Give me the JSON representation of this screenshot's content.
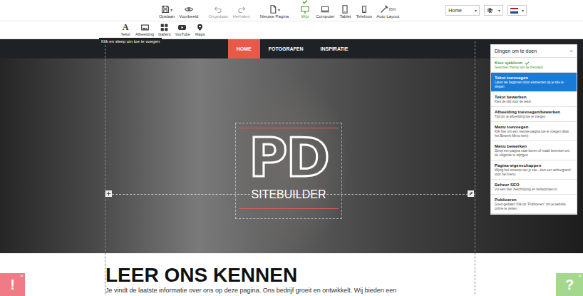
{
  "toolbar": {
    "caret": "▾",
    "items": [
      {
        "label": "Opslaan",
        "has_menu": true,
        "disabled": false,
        "selected": false
      },
      {
        "label": "Voorbeeld",
        "has_menu": false,
        "disabled": false,
        "selected": false
      },
      {
        "label": "Ongedaan",
        "has_menu": false,
        "disabled": true,
        "selected": false
      },
      {
        "label": "Herhalen",
        "has_menu": false,
        "disabled": true,
        "selected": false
      },
      {
        "label": "Nieuwe Pagina",
        "has_menu": true,
        "disabled": false,
        "selected": false
      },
      {
        "label": "Wijz",
        "has_menu": false,
        "disabled": false,
        "selected": true
      },
      {
        "label": "Computer",
        "has_menu": false,
        "disabled": false,
        "selected": false
      },
      {
        "label": "Tablet",
        "has_menu": false,
        "disabled": false,
        "selected": false
      },
      {
        "label": "Telefoon",
        "has_menu": false,
        "disabled": false,
        "selected": false
      },
      {
        "label": "Auto Layout",
        "has_menu": false,
        "disabled": false,
        "selected": false,
        "percent": "85%"
      }
    ],
    "page_select": {
      "value": "Home"
    }
  },
  "widgets": {
    "items": [
      {
        "label": "Tekst",
        "glyph": "A"
      },
      {
        "label": "Afbeelding"
      },
      {
        "label": "Gallerij"
      },
      {
        "label": "YouTube"
      },
      {
        "label": "Maps"
      }
    ],
    "tooltip": "Klik en sleep om toe te voegen"
  },
  "nav": {
    "items": [
      {
        "label": "HOME",
        "selected": true
      },
      {
        "label": "FOTOGRAFEN",
        "selected": false
      },
      {
        "label": "INSPIRATIE",
        "selected": false
      }
    ]
  },
  "hero": {
    "logo_mark": "PD",
    "logo_text": "SITEBUILDER"
  },
  "content": {
    "heading": "LEER ONS KENNEN",
    "paragraph": "Je vindt de laatste informatie over ons op deze pagina. Ons bedrijf groeit en ontwikkelt. Wij bieden een"
  },
  "todo_panel": {
    "title": "Dingen om te doen",
    "close": "×",
    "items": [
      {
        "title": "Kies sjabloon",
        "description": "Selecteer thema van de thema(s)",
        "done": true,
        "selected": false
      },
      {
        "title": "Tekst toevoegen",
        "description": "Laten we beginnen door elementen op je site te slepen",
        "done": false,
        "selected": true
      },
      {
        "title": "Tekst bewerken",
        "description": "Kies de stijl voor de tekst",
        "done": false,
        "selected": false
      },
      {
        "title": "Afbeelding toevoegen/bewerken",
        "description": "Tijd om je afbeelding toe te voegen",
        "done": false,
        "selected": false
      },
      {
        "title": "Menu toevoegen",
        "description": "Klik hier om een nieuwe pagina toe te voegen (klas het Bewerk Menu item)",
        "done": false,
        "selected": false
      },
      {
        "title": "Menu bewerken",
        "description": "Sleep een pagina naar boven of maak kenesten om de volgorde te wijzigen",
        "done": false,
        "selected": false
      },
      {
        "title": "Pagina-eigenschappen",
        "description": "Wijzig het ontwerp van je site - kies een achtergrond voor het menu",
        "done": false,
        "selected": false
      },
      {
        "title": "Beheer SEO",
        "description": "Vul een titel, beschrijving en trefwoorden in",
        "done": false,
        "selected": false
      },
      {
        "title": "Publiceren",
        "description": "Goed gedaan! Klik op \"Publiceren\" om je website online te zetten",
        "done": false,
        "selected": false
      }
    ]
  },
  "corner_buttons": {
    "alert": {
      "label": "!",
      "close": "×"
    },
    "help": {
      "label": "?",
      "close": "×"
    }
  }
}
